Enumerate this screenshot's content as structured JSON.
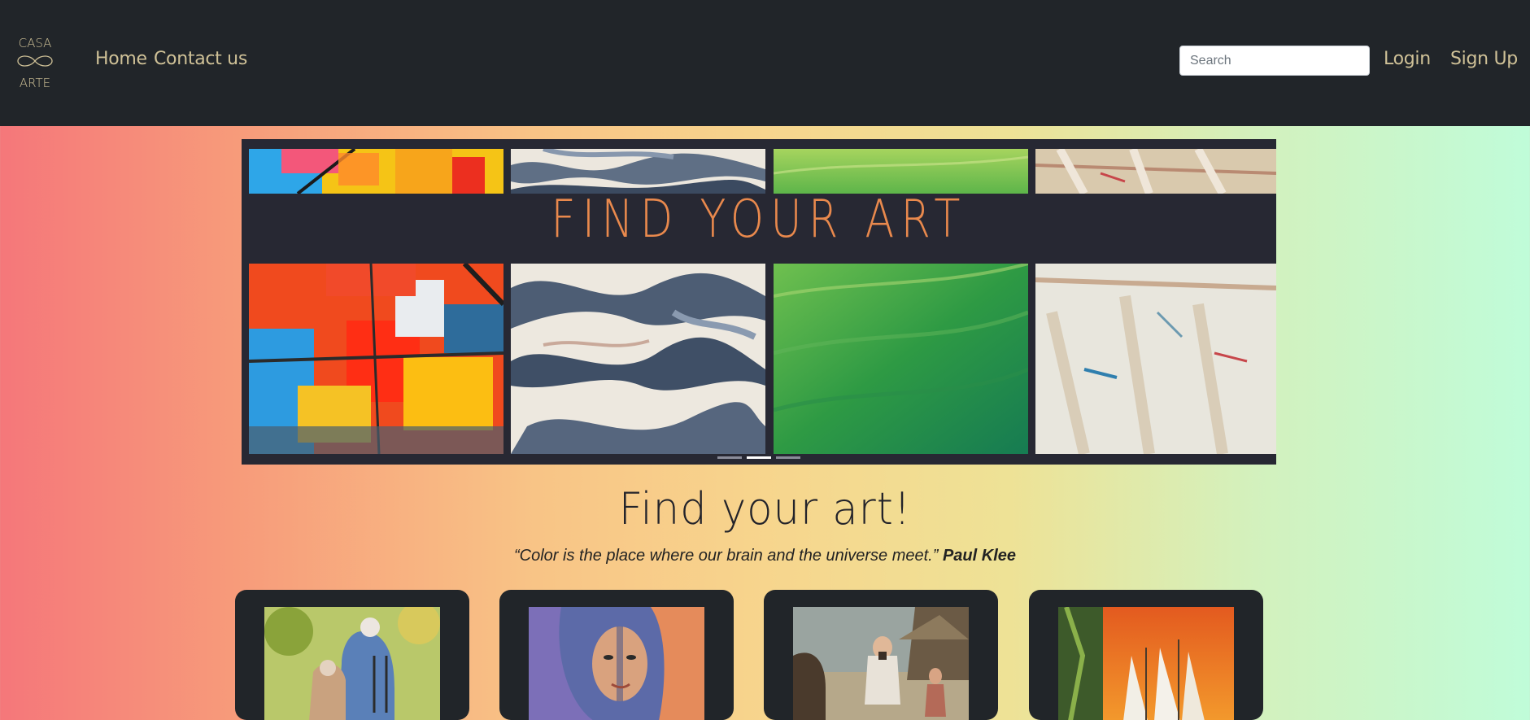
{
  "nav": {
    "logo_top": "CASA",
    "logo_bottom": "ARTE",
    "links": [
      "Home",
      "Contact us"
    ],
    "search_placeholder": "Search",
    "login": "Login",
    "signup": "Sign Up"
  },
  "carousel": {
    "title": "FIND YOUR ART",
    "indicator_count": 3,
    "active_indicator": 1
  },
  "main": {
    "heading": "Find your art!",
    "quote": "“Color is the place where our brain and the universe meet.”",
    "quote_author": "Paul Klee"
  },
  "cards": [
    {
      "image": "elderly-couple-painting"
    },
    {
      "image": "woman-portrait-painting"
    },
    {
      "image": "farmer-scene-painting"
    },
    {
      "image": "sailboats-sunset-painting"
    }
  ],
  "colors": {
    "navbar": "#212529",
    "nav_text": "#cfc197",
    "hero_title": "#e9894d",
    "hero_bg": "#272833"
  }
}
